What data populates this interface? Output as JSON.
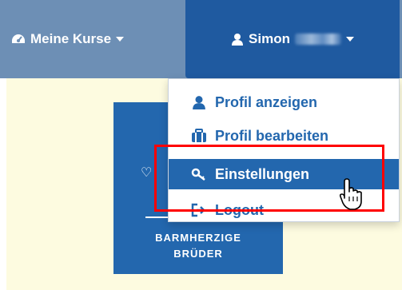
{
  "nav": {
    "courses_label": "Meine Kurse",
    "user_label": "Simon"
  },
  "dropdown": {
    "items": [
      {
        "label": "Profil anzeigen",
        "icon": "user-icon"
      },
      {
        "label": "Profil bearbeiten",
        "icon": "briefcase-icon"
      },
      {
        "label": "Einstellungen",
        "icon": "key-icon"
      },
      {
        "label": "Logout",
        "icon": "logout-icon"
      }
    ]
  },
  "logo": {
    "line1": "BARMHERZIGE",
    "line2": "BRÜDER"
  },
  "colors": {
    "navbar": "#6d8fb5",
    "accent": "#2367ae",
    "highlight": "#ff0000",
    "background": "#fdfbe0"
  }
}
